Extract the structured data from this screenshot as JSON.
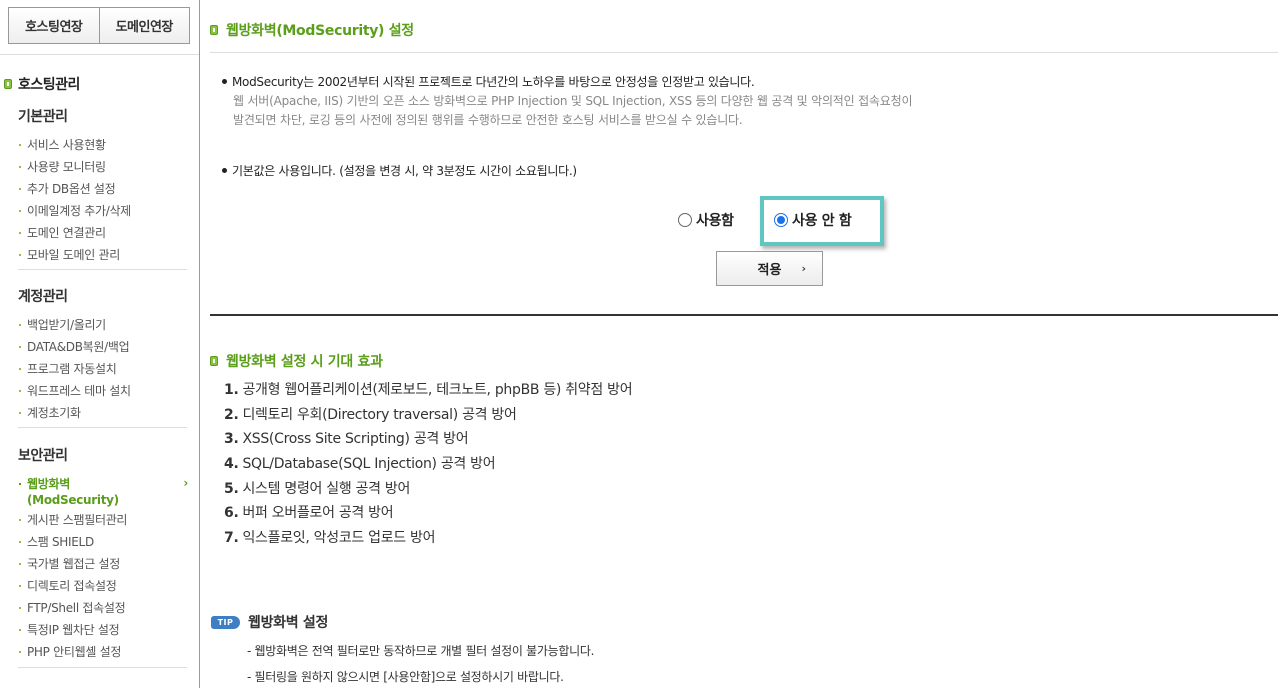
{
  "sidebar": {
    "top_buttons": [
      "호스팅연장",
      "도메인연장"
    ],
    "main_title": "호스팅관리",
    "sections": [
      {
        "title": "기본관리",
        "items": [
          "서비스 사용현황",
          "사용량 모니터링",
          "추가 DB옵션 설정",
          "이메일계정 추가/삭제",
          "도메인 연결관리",
          "모바일 도메인 관리"
        ]
      },
      {
        "title": "계정관리",
        "items": [
          "백업받기/올리기",
          "DATA&DB복원/백업",
          "프로그램 자동설치",
          "워드프레스 테마 설치",
          "계정초기화"
        ]
      },
      {
        "title": "보안관리",
        "active_item": "웹방화벽 (ModSecurity)",
        "items": [
          "게시판 스팸필터관리",
          "스팸 SHIELD",
          "국가별 웹접근 설정",
          "디렉토리 접속설정",
          "FTP/Shell 접속설정",
          "특정IP 웹차단 설정",
          "PHP 안티웹셸 설정"
        ]
      }
    ]
  },
  "main": {
    "section1_title": "웹방화벽(ModSecurity) 설정",
    "intro_bullet": "ModSecurity는 2002년부터 시작된 프로젝트로 다년간의 노하우를 바탕으로 안정성을 인정받고 있습니다.",
    "intro_desc": "웹 서버(Apache, IIS) 기반의 오픈 소스 방화벽으로 PHP Injection 및 SQL Injection, XSS 등의 다양한 웹 공격 및 악의적인 접속요청이 발견되면 차단, 로깅 등의 사전에 정의된 행위를 수행하므로 안전한 호스팅 서비스를 받으실 수 있습니다.",
    "default_bullet": "기본값은 사용입니다. (설정을 변경 시, 약 3분정도 시간이 소요됩니다.)",
    "radio_on_label": "사용함",
    "radio_off_label": "사용 안 함",
    "selected": "off",
    "apply_label": "적용",
    "apply_arrow": "›",
    "section2_title": "웹방화벽 설정 시 기대 효과",
    "effects": [
      {
        "num": "1.",
        "text": "공개형 웹어플리케이션(제로보드, 테크노트, phpBB 등) 취약점 방어"
      },
      {
        "num": "2.",
        "text": "디렉토리 우회(Directory traversal) 공격 방어"
      },
      {
        "num": "3.",
        "text": "XSS(Cross Site Scripting) 공격 방어"
      },
      {
        "num": "4.",
        "text": "SQL/Database(SQL Injection) 공격 방어"
      },
      {
        "num": "5.",
        "text": "시스템 명령어 실행 공격 방어"
      },
      {
        "num": "6.",
        "text": "버퍼 오버플로어 공격 방어"
      },
      {
        "num": "7.",
        "text": "익스플로잇, 악성코드 업로드 방어"
      }
    ],
    "tip_badge": "TIP",
    "tip_title": "웹방화벽 설정",
    "tip_lines": [
      "- 웹방화벽은 전역 필터로만 동작하므로 개별 필터 설정이 불가능합니다.",
      "- 필터링을 원하지 않으시면 [사용안함]으로 설정하시기 바랍니다."
    ]
  },
  "colors": {
    "accent_green": "#5a9e1a",
    "highlight_teal": "#5fc6c2",
    "radio_blue": "#1a73e8",
    "tip_blue": "#3e7fc4"
  }
}
